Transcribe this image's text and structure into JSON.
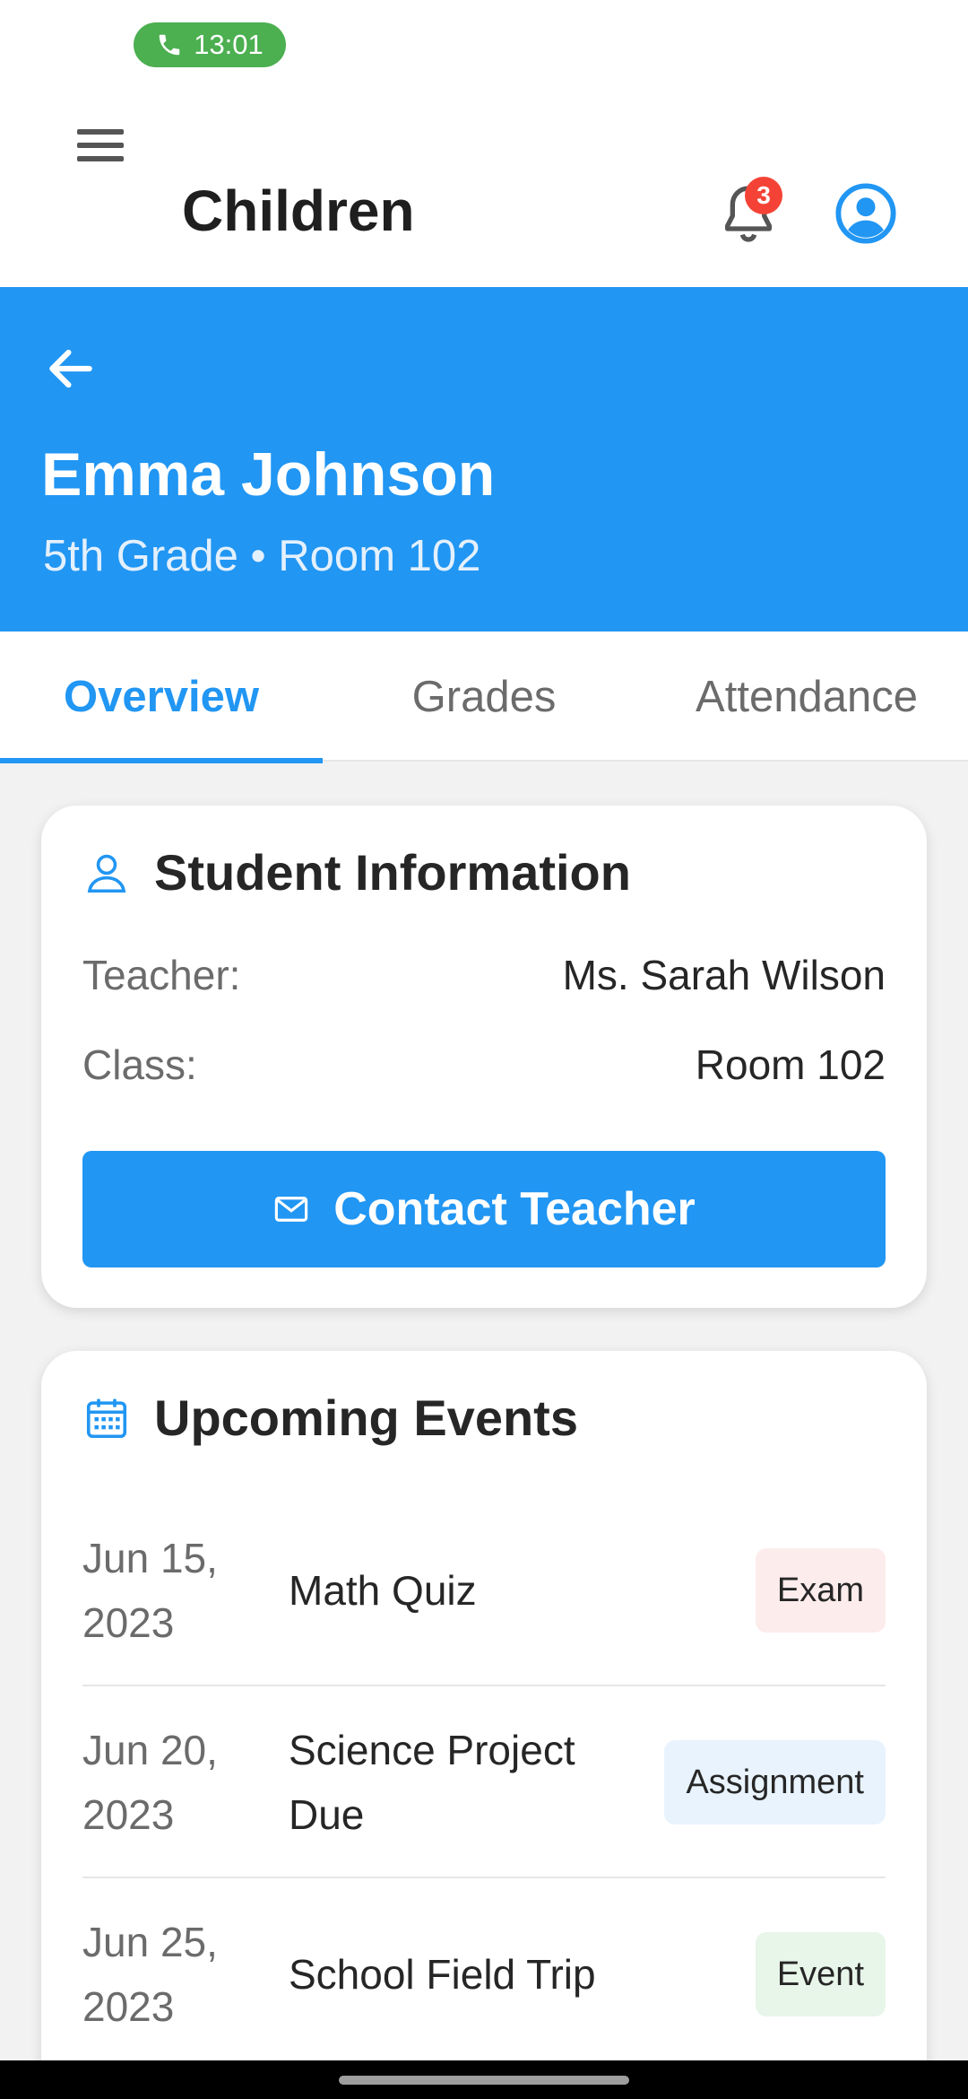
{
  "status_bar": {
    "time": "13:01"
  },
  "app_bar": {
    "title": "Children",
    "notification_count": "3"
  },
  "child": {
    "name": "Emma Johnson",
    "subtitle": "5th Grade • Room 102"
  },
  "tabs": [
    {
      "label": "Overview",
      "active": true
    },
    {
      "label": "Grades",
      "active": false
    },
    {
      "label": "Attendance",
      "active": false
    }
  ],
  "student_info": {
    "title": "Student Information",
    "teacher_label": "Teacher:",
    "teacher_value": "Ms. Sarah Wilson",
    "class_label": "Class:",
    "class_value": "Room 102",
    "contact_button": "Contact Teacher"
  },
  "events": {
    "title": "Upcoming Events",
    "items": [
      {
        "date": "Jun 15, 2023",
        "name": "Math Quiz",
        "tag": "Exam"
      },
      {
        "date": "Jun 20, 2023",
        "name": "Science Project Due",
        "tag": "Assignment"
      },
      {
        "date": "Jun 25, 2023",
        "name": "School Field Trip",
        "tag": "Event"
      }
    ]
  },
  "colors": {
    "primary": "#2196f3",
    "badge": "#f44336",
    "call_pill": "#4caf50"
  },
  "icons": [
    "phone-icon",
    "menu-icon",
    "bell-icon",
    "profile-icon",
    "back-arrow-icon",
    "person-icon",
    "mail-icon",
    "calendar-icon"
  ]
}
